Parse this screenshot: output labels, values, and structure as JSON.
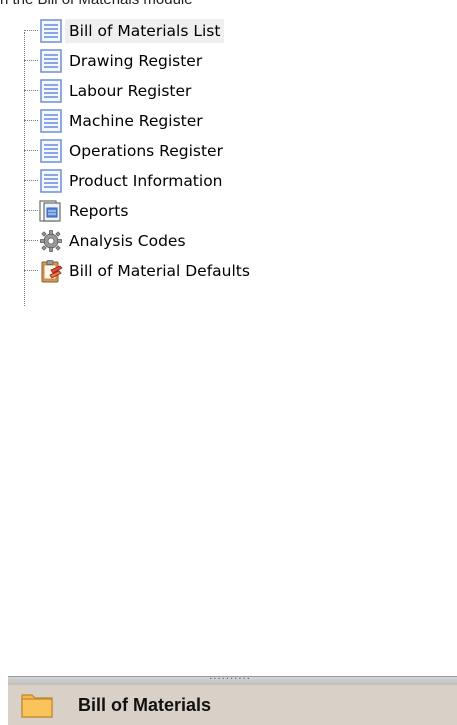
{
  "caption": "n the Bill of Materials module",
  "tree": {
    "items": [
      {
        "label": "Bill of Materials List",
        "icon": "list-document-icon",
        "selected": true
      },
      {
        "label": "Drawing Register",
        "icon": "list-document-icon"
      },
      {
        "label": "Labour Register",
        "icon": "list-document-icon"
      },
      {
        "label": "Machine Register",
        "icon": "list-document-icon"
      },
      {
        "label": "Operations Register",
        "icon": "list-document-icon"
      },
      {
        "label": "Product Information",
        "icon": "list-document-icon"
      },
      {
        "label": "Reports",
        "icon": "reports-icon"
      },
      {
        "label": "Analysis Codes",
        "icon": "gear-icon"
      },
      {
        "label": "Bill of Material Defaults",
        "icon": "clipboard-defaults-icon"
      }
    ]
  },
  "splitter": {
    "grip": "··········"
  },
  "module_bar": {
    "label": "Bill of Materials",
    "icon": "folder-icon"
  },
  "colors": {
    "list_icon_blue": "#6b8fd6",
    "selection_bg": "#efefef",
    "module_bar_bg": "#d9d0c7",
    "folder_orange": "#f6b84a"
  }
}
